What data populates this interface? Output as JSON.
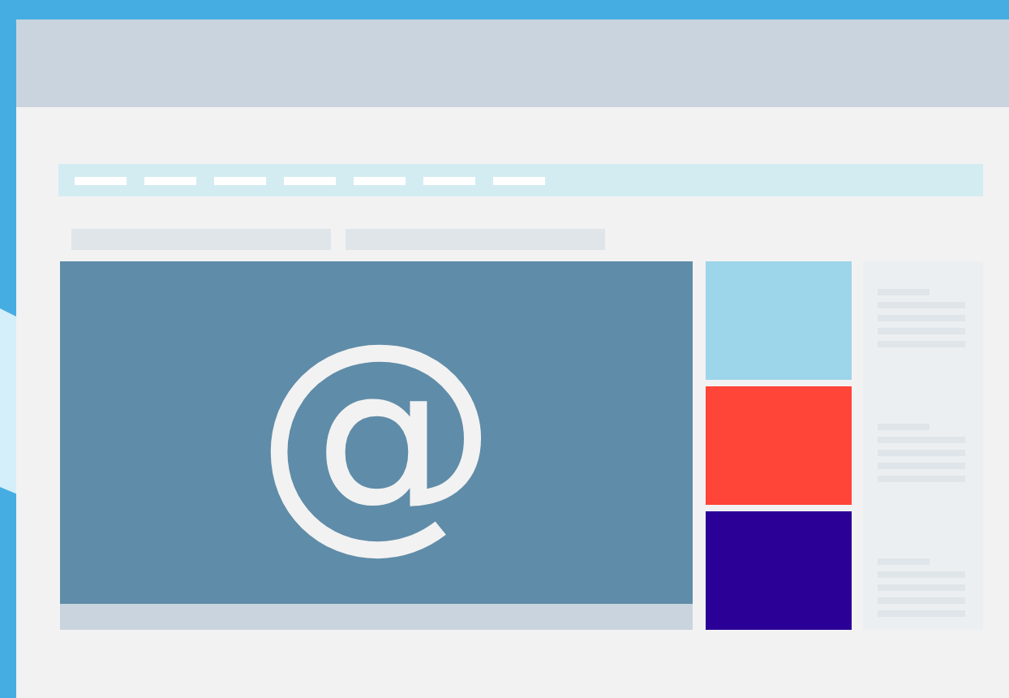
{
  "hero": {
    "symbol": "@"
  },
  "tiles": [
    {
      "color": "#9dd5ea"
    },
    {
      "color": "#ff4438"
    },
    {
      "color": "#2b0096"
    }
  ]
}
